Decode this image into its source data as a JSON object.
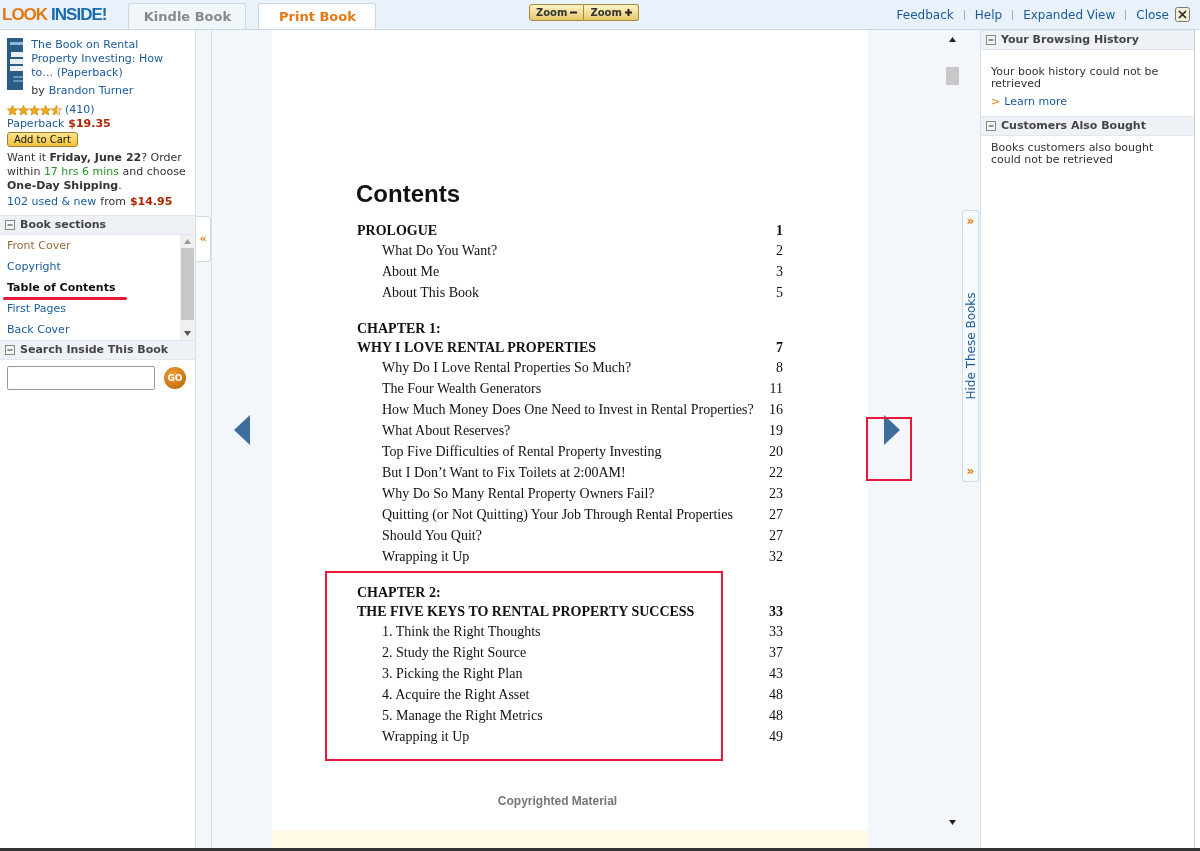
{
  "header": {
    "logo": [
      "LOOK",
      "INSIDE!"
    ],
    "tabs": [
      {
        "label": "Kindle Book",
        "selected": false
      },
      {
        "label": "Print Book",
        "selected": true
      }
    ],
    "zoom_buttons": [
      "Zoom",
      "Zoom"
    ],
    "links": [
      "Feedback",
      "Help",
      "Expanded View",
      "Close"
    ]
  },
  "book": {
    "title": "The Book on Rental Property Investing: How to… (Paperback)",
    "by": "by",
    "author": "Brandon Turner",
    "stars": 4.5,
    "reviews": "(410)",
    "format": "Paperback",
    "price": "$19.35",
    "add_to_cart": "Add to Cart",
    "delivery": "Want it **Friday, June 22**? Order within",
    "countdown": "17 hrs 6 mins",
    "delivery_end": "and choose **One-Day Shipping**.",
    "used_link": "102 used & new",
    "used_from": "from",
    "used_price": "$14.95"
  },
  "sections_panel": {
    "title": "Book sections",
    "expanded": true,
    "items": [
      {
        "label": "Front Cover",
        "selected": false,
        "visited": true,
        "underlined": false
      },
      {
        "label": "Copyright",
        "selected": false,
        "visited": false,
        "underlined": false
      },
      {
        "label": "Table of Contents",
        "selected": true,
        "visited": false,
        "underlined": true
      },
      {
        "label": "First Pages",
        "selected": false,
        "visited": false,
        "underlined": false
      },
      {
        "label": "Back Cover",
        "selected": false,
        "visited": false,
        "underlined": false
      }
    ]
  },
  "search_panel": {
    "title": "Search Inside This Book",
    "expanded": true,
    "button": "GO"
  },
  "collapse_tab": "«",
  "page": {
    "heading": "Contents",
    "sections": [
      {
        "lines": [
          "PROLOGUE"
        ],
        "page": "1",
        "highlighted": false,
        "entries": [
          {
            "title": "What Do You Want?",
            "page": "2"
          },
          {
            "title": "About Me",
            "page": "3"
          },
          {
            "title": "About This Book",
            "page": "5"
          }
        ]
      },
      {
        "lines": [
          "CHAPTER 1:",
          "WHY I LOVE RENTAL PROPERTIES"
        ],
        "page": "7",
        "highlighted": false,
        "entries": [
          {
            "title": "Why Do I Love Rental Properties So Much?",
            "page": "8"
          },
          {
            "title": "The Four Wealth Generators",
            "page": "11"
          },
          {
            "title": "How Much Money Does One Need to Invest in Rental Properties?",
            "page": "16"
          },
          {
            "title": "What About Reserves?",
            "page": "19"
          },
          {
            "title": "Top Five Difficulties of Rental Property Investing",
            "page": "20"
          },
          {
            "title": "But I Don’t Want to Fix Toilets at 2:00AM!",
            "page": "22"
          },
          {
            "title": "Why Do So Many Rental Property Owners Fail?",
            "page": "23"
          },
          {
            "title": "Quitting (or Not Quitting) Your Job Through Rental Properties",
            "page": "27"
          },
          {
            "title": "Should You Quit?",
            "page": "27"
          },
          {
            "title": "Wrapping it Up",
            "page": "32"
          }
        ]
      },
      {
        "lines": [
          "CHAPTER 2:",
          "THE FIVE KEYS TO RENTAL PROPERTY SUCCESS"
        ],
        "page": "33",
        "highlighted": true,
        "entries": [
          {
            "title": "1. Think the Right Thoughts",
            "page": "33"
          },
          {
            "title": "2. Study the Right Source",
            "page": "37"
          },
          {
            "title": "3. Picking the Right Plan",
            "page": "43"
          },
          {
            "title": "4. Acquire the Right Asset",
            "page": "48"
          },
          {
            "title": "5. Manage the Right Metrics",
            "page": "48"
          },
          {
            "title": "Wrapping it Up",
            "page": "49"
          }
        ]
      }
    ],
    "footer": "Copyrighted Material",
    "next_highlighted": true
  },
  "hide_tab": {
    "label": "Hide These Books",
    "arrows": [
      "»",
      "»"
    ]
  },
  "right_panels": [
    {
      "title": "Your Browsing History",
      "expanded": true,
      "text": "Your book history could not be retrieved",
      "link_prefix": ">",
      "link": "Learn more"
    },
    {
      "title": "Customers Also Bought",
      "expanded": true,
      "text": "Books customers also bought could not be retrieved"
    }
  ]
}
